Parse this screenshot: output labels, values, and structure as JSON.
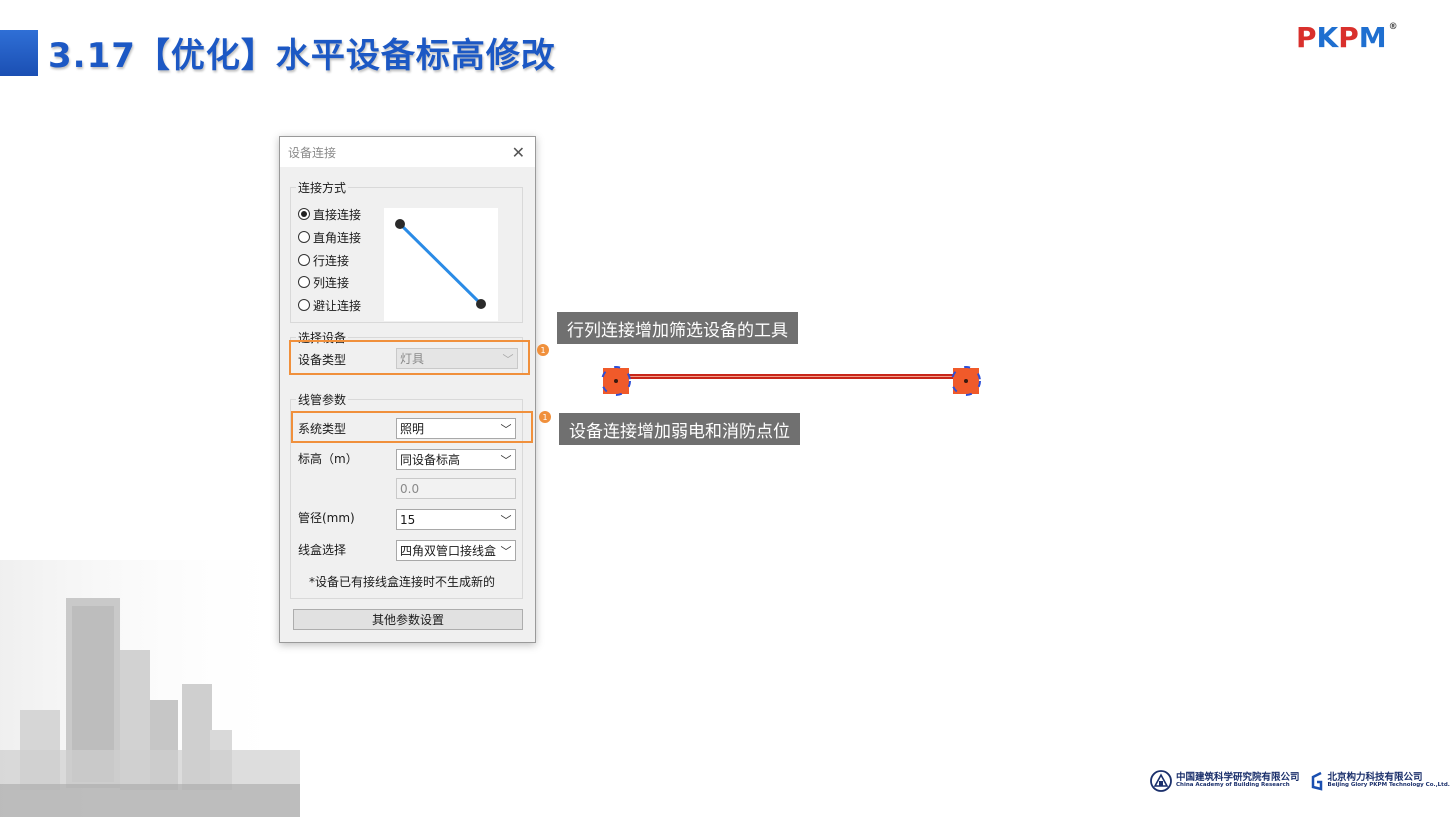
{
  "slide": {
    "title": "3.17【优化】水平设备标高修改"
  },
  "logo": {
    "letters": [
      "P",
      "K",
      "P",
      "M"
    ],
    "colors": [
      "#d9302c",
      "#1f6fd0",
      "#d9302c",
      "#1f6fd0"
    ],
    "registered": "®"
  },
  "dialog": {
    "title": "设备连接",
    "close_icon": "close-icon",
    "connection_group": {
      "label": "连接方式",
      "options": [
        "直接连接",
        "直角连接",
        "行连接",
        "列连接",
        "避让连接"
      ],
      "selected_index": 0
    },
    "device_group": {
      "label": "选择设备",
      "device_type_label": "设备类型",
      "device_type_value": "灯具"
    },
    "conduit_group": {
      "label": "线管参数",
      "system_type_label": "系统类型",
      "system_type_value": "照明",
      "elevation_label": "标高（m）",
      "elevation_value": "同设备标高",
      "elevation_input": "0.0",
      "diameter_label": "管径(mm)",
      "diameter_value": "15",
      "box_label": "线盒选择",
      "box_value": "四角双管口接线盒",
      "note": "*设备已有接线盒连接时不生成新的"
    },
    "other_button": "其他参数设置"
  },
  "callouts": {
    "first": "行列连接增加筛选设备的工具",
    "second": "设备连接增加弱电和消防点位",
    "badge": "1"
  },
  "colors": {
    "accent_orange": "#f0903c",
    "title_blue": "#1c58c4",
    "line_blue": "#2a8be6",
    "pipe_red": "#c8261a",
    "device_orange": "#f05a2a"
  },
  "footer": {
    "org1_cn": "中国建筑科学研究院有限公司",
    "org1_en": "China Academy of Building Research",
    "org2_cn": "北京构力科技有限公司",
    "org2_en": "Beijing Glory PKPM Technology Co.,Ltd."
  }
}
